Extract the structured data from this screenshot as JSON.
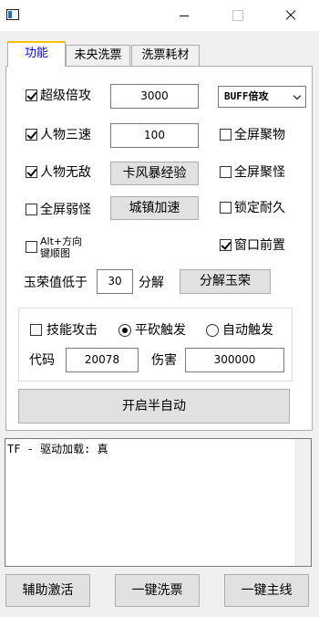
{
  "titlebar": {
    "icons": [
      "app-icon",
      "minimize-icon",
      "maximize-icon",
      "close-icon"
    ]
  },
  "tabs": [
    {
      "label": "功能",
      "active": true
    },
    {
      "label": "未央洗票",
      "active": false
    },
    {
      "label": "洗票耗材",
      "active": false
    }
  ],
  "features": {
    "super_multiplier": {
      "label": "超级倍攻",
      "checked": true,
      "value": "3000"
    },
    "buff_select": {
      "value": "BUFF倍攻"
    },
    "character_speed": {
      "label": "人物三速",
      "checked": true,
      "value": "100"
    },
    "fullscreen_gather": {
      "label": "全屏聚物",
      "checked": false
    },
    "character_invincible": {
      "label": "人物无敌",
      "checked": true
    },
    "wind_storm_button": "卡风暴经验",
    "fullscreen_gather_monster": {
      "label": "全屏聚怪",
      "checked": false
    },
    "fullscreen_weak": {
      "label": "全屏弱怪",
      "checked": false
    },
    "town_speed_button": "城镇加速",
    "lock_durability": {
      "label": "锁定耐久",
      "checked": false
    },
    "alt_direction": {
      "label_line1": "Alt+方向",
      "label_line2": "键顺图",
      "checked": false
    },
    "window_topmost": {
      "label": "窗口前置",
      "checked": true
    },
    "jade_label": "玉荣值低于",
    "jade_value": "30",
    "jade_unit": "分解",
    "decompose_button": "分解玉荣"
  },
  "skill_group": {
    "skill_attack": {
      "label": "技能攻击",
      "checked": false
    },
    "normal_trigger": {
      "label": "平砍触发",
      "selected": true
    },
    "auto_trigger": {
      "label": "自动触发",
      "selected": false
    },
    "code_label": "代码",
    "code_value": "20078",
    "damage_label": "伤害",
    "damage_value": "300000"
  },
  "start_button": "开启半自动",
  "log_text": "TF - 驱动加载: 真",
  "bottom_buttons": {
    "assist_activate": "辅助激活",
    "one_click_wash": "一键洗票",
    "one_click_mainline": "一键主线"
  }
}
